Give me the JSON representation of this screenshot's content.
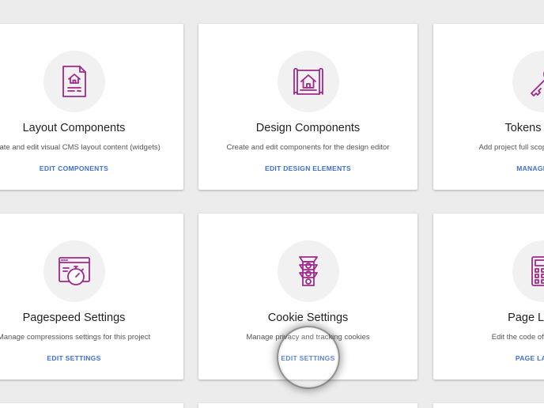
{
  "accent_color": "#a0288c",
  "link_color": "#3d6fd6",
  "cards": [
    {
      "icon": "document-house-icon",
      "title": "Layout Components",
      "description": "Create and edit visual CMS layout content (widgets)",
      "link": "EDIT COMPONENTS"
    },
    {
      "icon": "blueprint-house-icon",
      "title": "Design Components",
      "description": "Create and edit components for the design editor",
      "link": "EDIT DESIGN ELEMENTS"
    },
    {
      "icon": "key-icon",
      "title": "Tokens & Keys",
      "description": "Add project full scope tokens and keys",
      "link": "MANAGE KEYS"
    },
    {
      "icon": "browser-stopwatch-icon",
      "title": "Pagespeed Settings",
      "description": "Manage compressions settings for this project",
      "link": "EDIT SETTINGS"
    },
    {
      "icon": "traffic-light-icon",
      "title": "Cookie Settings",
      "description": "Manage privacy and tracking cookies",
      "link": "EDIT SETTINGS"
    },
    {
      "icon": "calculator-grid-icon",
      "title": "Page Layouts",
      "description": "Edit the code of design layouts",
      "link": "PAGE LAYOUTS"
    }
  ]
}
